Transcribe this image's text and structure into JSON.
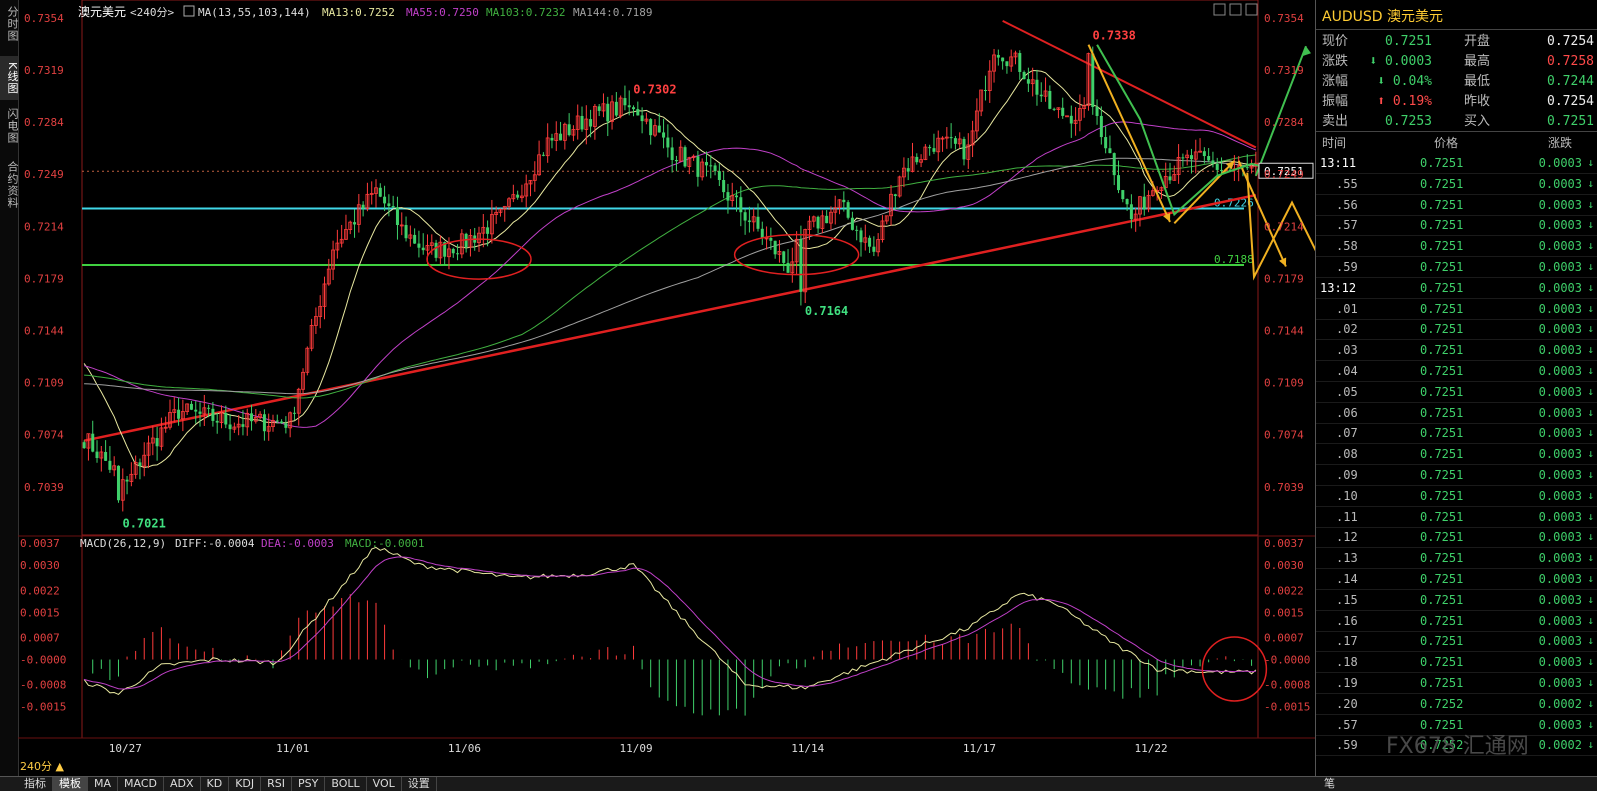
{
  "window": {
    "symbol_cn": "澳元美元",
    "period": "<240分>",
    "ma_params": "MA(13,55,103,144)",
    "ma13": "MA13:0.7252",
    "ma55": "MA55:0.7250",
    "ma103": "MA103:0.7232",
    "ma144": "MA144:0.7189",
    "macd_params": "MACD(26,12,9)",
    "diff": "DIFF:-0.0004",
    "dea": "DEA:-0.0003",
    "macd": "MACD:-0.0001",
    "period_selector": "240分 ▲",
    "current_price_box": "0.7251"
  },
  "left_tabs": [
    "分时图",
    "K线图",
    "闪电图",
    "合约资料"
  ],
  "bottom_tabs": [
    "指标",
    "模板",
    "MA",
    "MACD",
    "ADX",
    "KD",
    "KDJ",
    "RSI",
    "PSY",
    "BOLL",
    "VOL",
    "设置"
  ],
  "colors": {
    "up": "#ff3b3b",
    "down": "#3fd06a",
    "ma13": "#e8e8a0",
    "ma55": "#c040c8",
    "ma103": "#40b040",
    "ma144": "#a0a0a0",
    "diff": "#e8e8a0",
    "dea": "#c040c8",
    "support_cyan": "#40d8e8",
    "support_green": "#40d040"
  },
  "chart_data": {
    "type": "candlestick",
    "price_axis_ticks": [
      "0.7354",
      "0.7319",
      "0.7284",
      "0.7249",
      "0.7214",
      "0.7179",
      "0.7144",
      "0.7109",
      "0.7074",
      "0.7039"
    ],
    "price_ylim": [
      0.701,
      0.7362
    ],
    "x_ticks": [
      "10/27",
      "11/01",
      "11/06",
      "11/09",
      "11/14",
      "11/17",
      "11/22"
    ],
    "x_tick_index": [
      9,
      48,
      88,
      128,
      168,
      208,
      248
    ],
    "bar_count": 274,
    "anchors": [
      [
        0,
        0.7072
      ],
      [
        10,
        0.704
      ],
      [
        14,
        0.7062
      ],
      [
        22,
        0.709
      ],
      [
        35,
        0.7082
      ],
      [
        48,
        0.7083
      ],
      [
        58,
        0.72
      ],
      [
        68,
        0.7238
      ],
      [
        74,
        0.7212
      ],
      [
        80,
        0.7197
      ],
      [
        88,
        0.7202
      ],
      [
        98,
        0.7222
      ],
      [
        108,
        0.727
      ],
      [
        118,
        0.7288
      ],
      [
        128,
        0.7296
      ],
      [
        136,
        0.7267
      ],
      [
        146,
        0.7248
      ],
      [
        156,
        0.7215
      ],
      [
        164,
        0.7187
      ],
      [
        168,
        0.721
      ],
      [
        176,
        0.7228
      ],
      [
        184,
        0.7196
      ],
      [
        190,
        0.725
      ],
      [
        198,
        0.727
      ],
      [
        206,
        0.7265
      ],
      [
        212,
        0.7335
      ],
      [
        218,
        0.7322
      ],
      [
        226,
        0.729
      ],
      [
        236,
        0.7288
      ],
      [
        244,
        0.7218
      ],
      [
        250,
        0.7245
      ],
      [
        258,
        0.726
      ],
      [
        266,
        0.7252
      ],
      [
        273,
        0.7251
      ]
    ],
    "high_labels": [
      {
        "bar": 234,
        "price": 0.7338,
        "text": "0.7338"
      },
      {
        "bar": 127,
        "price": 0.7302,
        "text": "0.7302"
      }
    ],
    "low_labels": [
      {
        "bar": 8,
        "price": 0.7021,
        "text": "0.7021"
      },
      {
        "bar": 167,
        "price": 0.7164,
        "text": "0.7164"
      }
    ],
    "support_lines": [
      {
        "price": 0.7226,
        "text": "0.7226",
        "color": "#40d8e8"
      },
      {
        "price": 0.7188,
        "text": "0.7188",
        "color": "#40d040"
      }
    ],
    "current_price": 0.7251,
    "macd_axis_ticks": [
      "0.0037",
      "0.0030",
      "0.0022",
      "0.0015",
      "0.0007",
      "-0.0000",
      "-0.0008",
      "-0.0015"
    ],
    "macd_ylim": [
      -0.0024,
      0.0038
    ],
    "macd_anchors": [
      [
        0,
        -0.0007
      ],
      [
        8,
        -0.0011
      ],
      [
        18,
        -0.0002
      ],
      [
        30,
        0.0
      ],
      [
        45,
        -0.0001
      ],
      [
        58,
        0.002
      ],
      [
        68,
        0.0036
      ],
      [
        78,
        0.003
      ],
      [
        100,
        0.0026
      ],
      [
        116,
        0.0027
      ],
      [
        128,
        0.003
      ],
      [
        140,
        0.0012
      ],
      [
        154,
        -0.0008
      ],
      [
        168,
        -0.0009
      ],
      [
        180,
        -0.0003
      ],
      [
        194,
        0.0004
      ],
      [
        206,
        0.001
      ],
      [
        218,
        0.0021
      ],
      [
        226,
        0.0018
      ],
      [
        240,
        0.0005
      ],
      [
        250,
        -0.0003
      ],
      [
        262,
        -0.0004
      ],
      [
        273,
        -0.0004
      ]
    ]
  },
  "right_panel": {
    "title": "AUDUSD 澳元美元",
    "quote_rows": [
      {
        "l1": "现价",
        "v1": "0.7251",
        "c1": "green",
        "l2": "开盘",
        "v2": "0.7254",
        "c2": "white"
      },
      {
        "l1": "涨跌",
        "v1": "⬇ 0.0003",
        "c1": "green",
        "l2": "最高",
        "v2": "0.7258",
        "c2": "red"
      },
      {
        "l1": "涨幅",
        "v1": "⬇ 0.04%",
        "c1": "green",
        "l2": "最低",
        "v2": "0.7244",
        "c2": "green"
      },
      {
        "l1": "振幅",
        "v1": "⬆ 0.19%",
        "c1": "red",
        "l2": "昨收",
        "v2": "0.7254",
        "c2": "white"
      },
      {
        "l1": "卖出",
        "v1": "0.7253",
        "c1": "green",
        "l2": "买入",
        "v2": "0.7251",
        "c2": "green"
      }
    ],
    "tick_header": [
      "时间",
      "价格",
      "涨跌"
    ],
    "ticks": [
      {
        "t": "13:11",
        "p": "0.7251",
        "c": "0.0003"
      },
      {
        "t": ".55",
        "p": "0.7251",
        "c": "0.0003"
      },
      {
        "t": ".56",
        "p": "0.7251",
        "c": "0.0003"
      },
      {
        "t": ".57",
        "p": "0.7251",
        "c": "0.0003"
      },
      {
        "t": ".58",
        "p": "0.7251",
        "c": "0.0003"
      },
      {
        "t": ".59",
        "p": "0.7251",
        "c": "0.0003"
      },
      {
        "t": "13:12",
        "p": "0.7251",
        "c": "0.0003"
      },
      {
        "t": ".01",
        "p": "0.7251",
        "c": "0.0003"
      },
      {
        "t": ".02",
        "p": "0.7251",
        "c": "0.0003"
      },
      {
        "t": ".03",
        "p": "0.7251",
        "c": "0.0003"
      },
      {
        "t": ".04",
        "p": "0.7251",
        "c": "0.0003"
      },
      {
        "t": ".05",
        "p": "0.7251",
        "c": "0.0003"
      },
      {
        "t": ".06",
        "p": "0.7251",
        "c": "0.0003"
      },
      {
        "t": ".07",
        "p": "0.7251",
        "c": "0.0003"
      },
      {
        "t": ".08",
        "p": "0.7251",
        "c": "0.0003"
      },
      {
        "t": ".09",
        "p": "0.7251",
        "c": "0.0003"
      },
      {
        "t": ".10",
        "p": "0.7251",
        "c": "0.0003"
      },
      {
        "t": ".11",
        "p": "0.7251",
        "c": "0.0003"
      },
      {
        "t": ".12",
        "p": "0.7251",
        "c": "0.0003"
      },
      {
        "t": ".13",
        "p": "0.7251",
        "c": "0.0003"
      },
      {
        "t": ".14",
        "p": "0.7251",
        "c": "0.0003"
      },
      {
        "t": ".15",
        "p": "0.7251",
        "c": "0.0003"
      },
      {
        "t": ".16",
        "p": "0.7251",
        "c": "0.0003"
      },
      {
        "t": ".17",
        "p": "0.7251",
        "c": "0.0003"
      },
      {
        "t": ".18",
        "p": "0.7251",
        "c": "0.0003"
      },
      {
        "t": ".19",
        "p": "0.7251",
        "c": "0.0003"
      },
      {
        "t": ".20",
        "p": "0.7252",
        "c": "0.0002"
      },
      {
        "t": ".57",
        "p": "0.7251",
        "c": "0.0003"
      },
      {
        "t": ".59",
        "p": "0.7252",
        "c": "0.0002"
      }
    ],
    "footer_tab": "笔",
    "watermark": "FX678 汇通网"
  }
}
